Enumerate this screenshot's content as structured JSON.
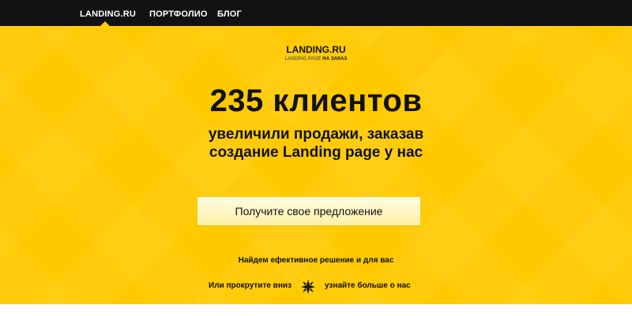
{
  "nav": {
    "items": [
      {
        "label": "LANDING.RU"
      },
      {
        "label": "ПОРТФОЛИО"
      },
      {
        "label": "БЛОГ"
      }
    ]
  },
  "hero": {
    "logo": "LANDING.RU",
    "logo_sub_prefix": "LANDING PAGE ",
    "logo_sub_bold": "НА ЗАКАЗ",
    "headline": "235 клиентов",
    "subhead_line1": "увеличили продажи, заказав",
    "subhead_line2": "создание Landing page у нас",
    "cta_label": "Получите свое предложение",
    "note": "Найдем ефективное решение и для вас",
    "scroll_left": "Или прокрутите вниз",
    "scroll_right": "узнайте больше о нас"
  },
  "icons": {
    "scroll": "scroll-down-star-icon"
  },
  "colors": {
    "accent": "#ffc900",
    "nav_bg": "#121212",
    "text": "#111111"
  }
}
